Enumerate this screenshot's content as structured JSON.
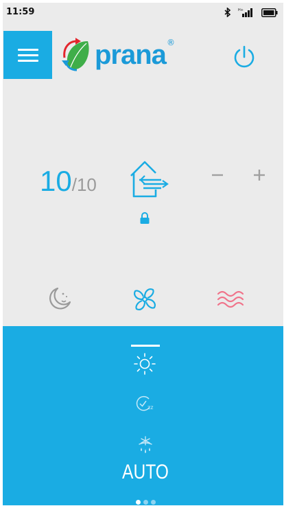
{
  "status_bar": {
    "time": "11:59",
    "icons": [
      "bluetooth-icon",
      "signal-icon",
      "battery-icon"
    ],
    "signal_label": "H+"
  },
  "app_bar": {
    "menu_icon": "hamburger-menu-icon",
    "logo_text": "prana",
    "logo_registered": "®",
    "power_icon": "power-icon"
  },
  "speed": {
    "current": "10",
    "separator_max": "/10",
    "mode_icon": "house-airflow-icon",
    "minus": "−",
    "plus": "+",
    "lock_icon": "lock-icon"
  },
  "functions": [
    {
      "name": "night-mode",
      "icon": "moon-icon"
    },
    {
      "name": "fan",
      "icon": "fan-icon"
    },
    {
      "name": "heating",
      "icon": "heat-waves-icon"
    }
  ],
  "mode_panel": {
    "icons": [
      "sun-icon",
      "sleep-timer-icon",
      "winter-icon"
    ],
    "label": "AUTO",
    "pages": 3,
    "active_page": 1
  },
  "colors": {
    "accent": "#1aace3",
    "background": "#ebebeb",
    "heat": "#f0738a",
    "muted": "#9a9a9a",
    "logo_leaf": "#3fae49",
    "logo_arrow": "#e3262d"
  }
}
